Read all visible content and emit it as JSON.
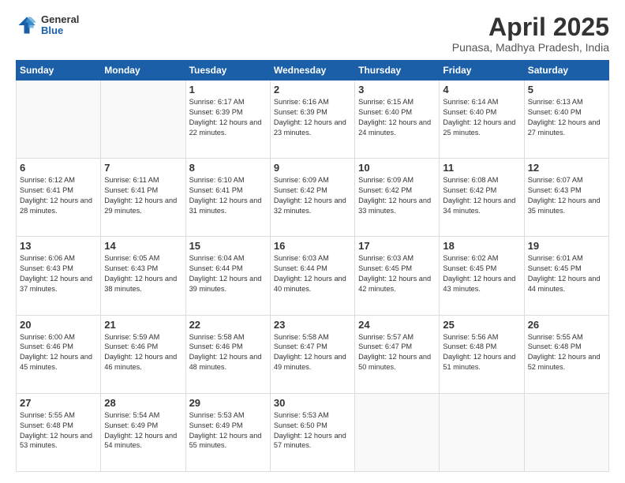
{
  "header": {
    "logo_general": "General",
    "logo_blue": "Blue",
    "title": "April 2025",
    "location": "Punasa, Madhya Pradesh, India"
  },
  "days_of_week": [
    "Sunday",
    "Monday",
    "Tuesday",
    "Wednesday",
    "Thursday",
    "Friday",
    "Saturday"
  ],
  "weeks": [
    [
      {
        "day": "",
        "sunrise": "",
        "sunset": "",
        "daylight": ""
      },
      {
        "day": "",
        "sunrise": "",
        "sunset": "",
        "daylight": ""
      },
      {
        "day": "1",
        "sunrise": "Sunrise: 6:17 AM",
        "sunset": "Sunset: 6:39 PM",
        "daylight": "Daylight: 12 hours and 22 minutes."
      },
      {
        "day": "2",
        "sunrise": "Sunrise: 6:16 AM",
        "sunset": "Sunset: 6:39 PM",
        "daylight": "Daylight: 12 hours and 23 minutes."
      },
      {
        "day": "3",
        "sunrise": "Sunrise: 6:15 AM",
        "sunset": "Sunset: 6:40 PM",
        "daylight": "Daylight: 12 hours and 24 minutes."
      },
      {
        "day": "4",
        "sunrise": "Sunrise: 6:14 AM",
        "sunset": "Sunset: 6:40 PM",
        "daylight": "Daylight: 12 hours and 25 minutes."
      },
      {
        "day": "5",
        "sunrise": "Sunrise: 6:13 AM",
        "sunset": "Sunset: 6:40 PM",
        "daylight": "Daylight: 12 hours and 27 minutes."
      }
    ],
    [
      {
        "day": "6",
        "sunrise": "Sunrise: 6:12 AM",
        "sunset": "Sunset: 6:41 PM",
        "daylight": "Daylight: 12 hours and 28 minutes."
      },
      {
        "day": "7",
        "sunrise": "Sunrise: 6:11 AM",
        "sunset": "Sunset: 6:41 PM",
        "daylight": "Daylight: 12 hours and 29 minutes."
      },
      {
        "day": "8",
        "sunrise": "Sunrise: 6:10 AM",
        "sunset": "Sunset: 6:41 PM",
        "daylight": "Daylight: 12 hours and 31 minutes."
      },
      {
        "day": "9",
        "sunrise": "Sunrise: 6:09 AM",
        "sunset": "Sunset: 6:42 PM",
        "daylight": "Daylight: 12 hours and 32 minutes."
      },
      {
        "day": "10",
        "sunrise": "Sunrise: 6:09 AM",
        "sunset": "Sunset: 6:42 PM",
        "daylight": "Daylight: 12 hours and 33 minutes."
      },
      {
        "day": "11",
        "sunrise": "Sunrise: 6:08 AM",
        "sunset": "Sunset: 6:42 PM",
        "daylight": "Daylight: 12 hours and 34 minutes."
      },
      {
        "day": "12",
        "sunrise": "Sunrise: 6:07 AM",
        "sunset": "Sunset: 6:43 PM",
        "daylight": "Daylight: 12 hours and 35 minutes."
      }
    ],
    [
      {
        "day": "13",
        "sunrise": "Sunrise: 6:06 AM",
        "sunset": "Sunset: 6:43 PM",
        "daylight": "Daylight: 12 hours and 37 minutes."
      },
      {
        "day": "14",
        "sunrise": "Sunrise: 6:05 AM",
        "sunset": "Sunset: 6:43 PM",
        "daylight": "Daylight: 12 hours and 38 minutes."
      },
      {
        "day": "15",
        "sunrise": "Sunrise: 6:04 AM",
        "sunset": "Sunset: 6:44 PM",
        "daylight": "Daylight: 12 hours and 39 minutes."
      },
      {
        "day": "16",
        "sunrise": "Sunrise: 6:03 AM",
        "sunset": "Sunset: 6:44 PM",
        "daylight": "Daylight: 12 hours and 40 minutes."
      },
      {
        "day": "17",
        "sunrise": "Sunrise: 6:03 AM",
        "sunset": "Sunset: 6:45 PM",
        "daylight": "Daylight: 12 hours and 42 minutes."
      },
      {
        "day": "18",
        "sunrise": "Sunrise: 6:02 AM",
        "sunset": "Sunset: 6:45 PM",
        "daylight": "Daylight: 12 hours and 43 minutes."
      },
      {
        "day": "19",
        "sunrise": "Sunrise: 6:01 AM",
        "sunset": "Sunset: 6:45 PM",
        "daylight": "Daylight: 12 hours and 44 minutes."
      }
    ],
    [
      {
        "day": "20",
        "sunrise": "Sunrise: 6:00 AM",
        "sunset": "Sunset: 6:46 PM",
        "daylight": "Daylight: 12 hours and 45 minutes."
      },
      {
        "day": "21",
        "sunrise": "Sunrise: 5:59 AM",
        "sunset": "Sunset: 6:46 PM",
        "daylight": "Daylight: 12 hours and 46 minutes."
      },
      {
        "day": "22",
        "sunrise": "Sunrise: 5:58 AM",
        "sunset": "Sunset: 6:46 PM",
        "daylight": "Daylight: 12 hours and 48 minutes."
      },
      {
        "day": "23",
        "sunrise": "Sunrise: 5:58 AM",
        "sunset": "Sunset: 6:47 PM",
        "daylight": "Daylight: 12 hours and 49 minutes."
      },
      {
        "day": "24",
        "sunrise": "Sunrise: 5:57 AM",
        "sunset": "Sunset: 6:47 PM",
        "daylight": "Daylight: 12 hours and 50 minutes."
      },
      {
        "day": "25",
        "sunrise": "Sunrise: 5:56 AM",
        "sunset": "Sunset: 6:48 PM",
        "daylight": "Daylight: 12 hours and 51 minutes."
      },
      {
        "day": "26",
        "sunrise": "Sunrise: 5:55 AM",
        "sunset": "Sunset: 6:48 PM",
        "daylight": "Daylight: 12 hours and 52 minutes."
      }
    ],
    [
      {
        "day": "27",
        "sunrise": "Sunrise: 5:55 AM",
        "sunset": "Sunset: 6:48 PM",
        "daylight": "Daylight: 12 hours and 53 minutes."
      },
      {
        "day": "28",
        "sunrise": "Sunrise: 5:54 AM",
        "sunset": "Sunset: 6:49 PM",
        "daylight": "Daylight: 12 hours and 54 minutes."
      },
      {
        "day": "29",
        "sunrise": "Sunrise: 5:53 AM",
        "sunset": "Sunset: 6:49 PM",
        "daylight": "Daylight: 12 hours and 55 minutes."
      },
      {
        "day": "30",
        "sunrise": "Sunrise: 5:53 AM",
        "sunset": "Sunset: 6:50 PM",
        "daylight": "Daylight: 12 hours and 57 minutes."
      },
      {
        "day": "",
        "sunrise": "",
        "sunset": "",
        "daylight": ""
      },
      {
        "day": "",
        "sunrise": "",
        "sunset": "",
        "daylight": ""
      },
      {
        "day": "",
        "sunrise": "",
        "sunset": "",
        "daylight": ""
      }
    ]
  ]
}
